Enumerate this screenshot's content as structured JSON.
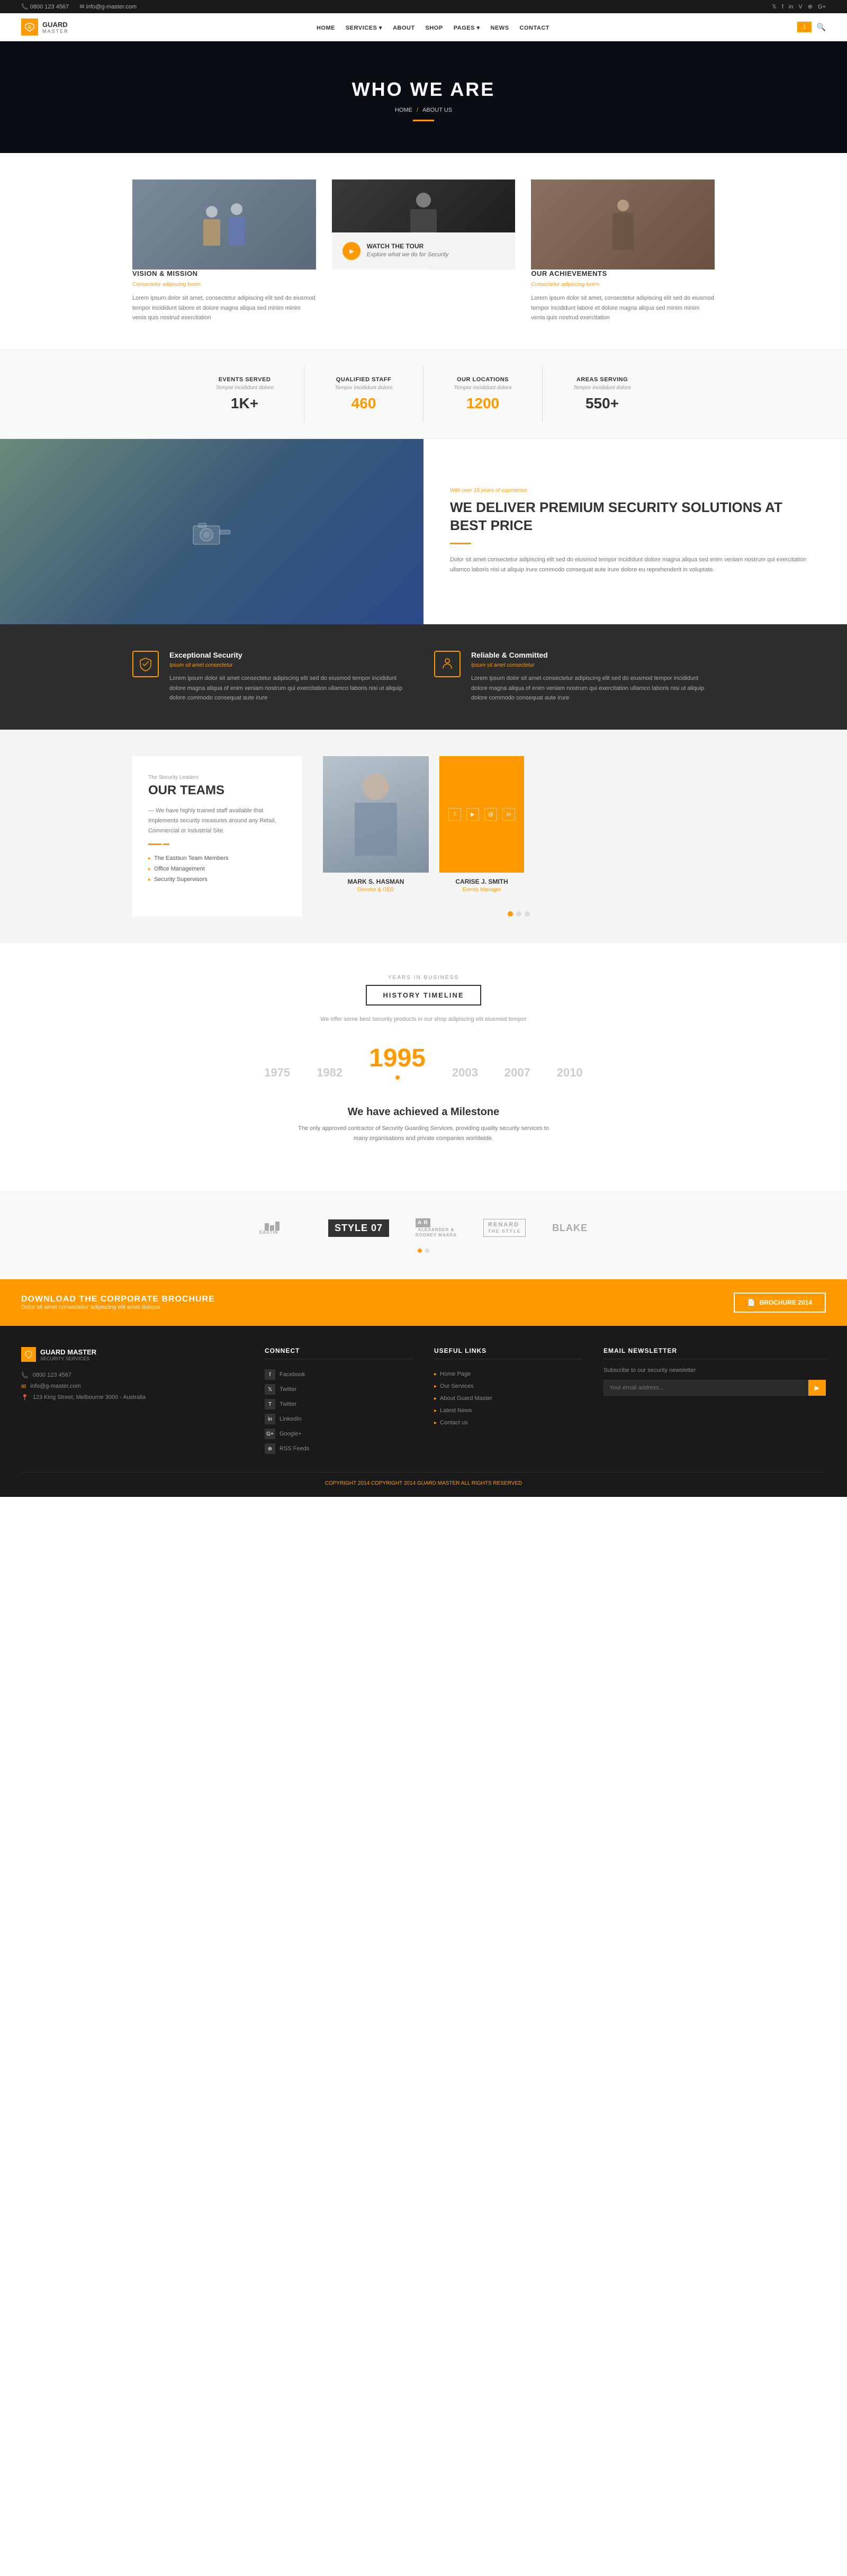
{
  "topbar": {
    "phone": "0800 123 4567",
    "email": "info@g-master.com",
    "phone_icon": "📞",
    "email_icon": "✉"
  },
  "nav": {
    "logo_title": "GUARD",
    "logo_subtitle": "MASTER",
    "links": [
      "HOME",
      "SERVICES",
      "ABOUT",
      "SHOP",
      "PAGES",
      "NEWS",
      "CONTACT"
    ],
    "cart_count": "1"
  },
  "hero": {
    "title": "WHO WE ARE",
    "breadcrumb_home": "HOME",
    "breadcrumb_current": "ABOUT US"
  },
  "vision": {
    "left": {
      "title": "VISION & MISSION",
      "subtitle": "Consectetur adipiscing lorem",
      "body": "Lorem ipsum dolor sit amet, consectetur adipiscing elit sed do eiusmod tempor incididunt labore et dolore magna aliqua sed minim minim venia quis nostrud exercitation"
    },
    "center": {
      "watch_title": "WATCH THE TOUR",
      "watch_subtitle": "Explore what we do for Security"
    },
    "right": {
      "title": "OUR ACHIEVEMENTS",
      "subtitle": "Consectetur adipiscing lorem",
      "body": "Lorem ipsum dolor sit amet, consectetur adipiscing elit sed do eiusmod tempor incididunt labore et dolore magna aliqua sed minim minim venia quis nostrud exercitation"
    }
  },
  "stats": [
    {
      "label": "EVENTS SERVED",
      "sub": "Tempor incididunt dolore",
      "number": "1K+",
      "color": "black"
    },
    {
      "label": "QUALIFIED STAFF",
      "sub": "Tempor incididunt dolore",
      "number": "460",
      "color": "orange"
    },
    {
      "label": "OUR LOCATIONS",
      "sub": "Tempor incididunt dolore",
      "number": "1200",
      "color": "orange"
    },
    {
      "label": "AREAS SERVING",
      "sub": "Tempor incididunt dolore",
      "number": "550+",
      "color": "black"
    }
  ],
  "premium": {
    "eyebrow": "With over 15 years of experience",
    "title": "WE DELIVER PREMIUM SECURITY SOLUTIONS AT BEST PRICE",
    "body": "Dolor sit amet consectetur adipiscing elit sed do eiusmod tempor incididunt dolore magna aliqua sed enim veniam nostrum qui exercitation ullamco laboris nisi ut aliquip irure commodo consequat aute irure dolore eu reprehenderit in voluptate."
  },
  "features": [
    {
      "icon": "🛡",
      "title": "Exceptional Security",
      "subtitle": "Ipsum sit amet consectetur",
      "body": "Lorem ipsum dolor sit amet consectetur adipiscing elit sed do eiusmod tempor incididunt dolore magna aliqua of enim veniam nostrum qui exercitation ullamco laboris nisi ut aliquip dolore commodo consequat aute irure"
    },
    {
      "icon": "👤",
      "title": "Reliable & Committed",
      "subtitle": "Ipsum sit amet consectetur",
      "body": "Lorem ipsum dolor sit amet consectetur adipiscing elit sed do eiusmod tempor incididunt dolore magna aliqua of enim veniam nostrum qui exercitation ullamco laboris nisi ut aliquip dolore commodo consequat aute irure"
    }
  ],
  "team": {
    "eyebrow": "The Security Leaders",
    "title": "OUR TEAMS",
    "description": "— We have highly trained staff available that Implements security measures around any Retail, Commercial or Industrial Site.",
    "list": [
      "The Eastsun Team Members",
      "Office Management",
      "Security Supervisors"
    ],
    "members": [
      {
        "name": "MARK S. HASMAN",
        "role": "Director & CEO"
      },
      {
        "name": "CARISE J. SMITH",
        "role": "Events Manager"
      }
    ]
  },
  "timeline": {
    "eyebrow": "YEARS IN BUSINESS",
    "title": "HISTORY TIMELINE",
    "description": "We offer some best security products in our shop adipiscing elit eiusmod tempor",
    "years": [
      "1975",
      "1982",
      "1995",
      "2003",
      "2007",
      "2010"
    ],
    "active_year": "1995",
    "milestone_title": "We have achieved a Milestone",
    "milestone_body": "The only approved contractor of Security Guarding Services, providing quality security services to many organisations and private companies worldwide."
  },
  "partners": {
    "logos": [
      "EASTIN",
      "STYLE 07",
      "ALEXANDER & RODNEY MAARA",
      "RENARD THE",
      "BLAKE"
    ]
  },
  "cta": {
    "title": "DOWNLOAD THE CORPORATE BROCHURE",
    "subtitle": "Dolor sit amet consectetur adipiscing elit amet dolique",
    "btn": "BROCHURE 2014"
  },
  "footer": {
    "logo": "GUARD MASTER",
    "logo_sub": "SECURITY SERVICES",
    "contact": [
      {
        "icon": "📞",
        "text": "0800 123 4567"
      },
      {
        "icon": "✉",
        "text": "info@g-master.com"
      },
      {
        "icon": "📍",
        "text": "123 King Street, Melbourne 3000 - Australia"
      }
    ],
    "connect": {
      "title": "CONNECT",
      "links": [
        "Facebook",
        "Twitter",
        "Twitter",
        "LinkedIn",
        "Google+",
        "RSS Feeds"
      ]
    },
    "useful": {
      "title": "USEFUL LINKS",
      "links": [
        "Home Page",
        "Our Services",
        "About Guard Master",
        "Latest News",
        "Contact us"
      ]
    },
    "newsletter": {
      "title": "EMAIL NEWSLETTER",
      "text": "Subscribe to our security newsletter",
      "placeholder": ""
    },
    "copyright": "COPYRIGHT 2014 GUARD MASTER ALL RIGHTS RESERVED"
  }
}
